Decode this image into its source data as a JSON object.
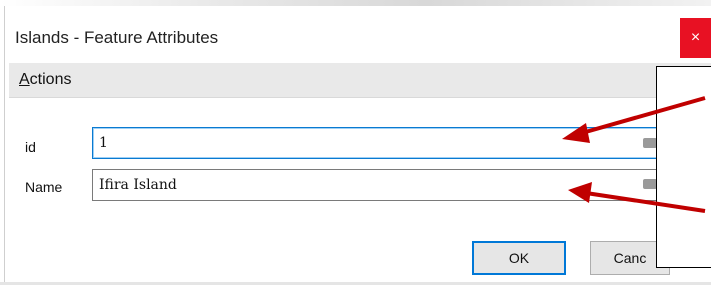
{
  "window": {
    "title": "Islands - Feature Attributes",
    "close_glyph": "×"
  },
  "menu": {
    "actions_first": "A",
    "actions_rest": "ctions"
  },
  "fields": {
    "id": {
      "label": "id",
      "value": "1"
    },
    "name": {
      "label": "Name",
      "value": "Ifira Island"
    }
  },
  "buttons": {
    "ok": "OK",
    "cancel": "Canc"
  },
  "icons": {
    "clear": "clear-text-icon",
    "arrow": "red-annotation-arrow"
  },
  "colors": {
    "accent": "#0a7ad1",
    "close": "#e81123",
    "annotation": "#c00000"
  }
}
